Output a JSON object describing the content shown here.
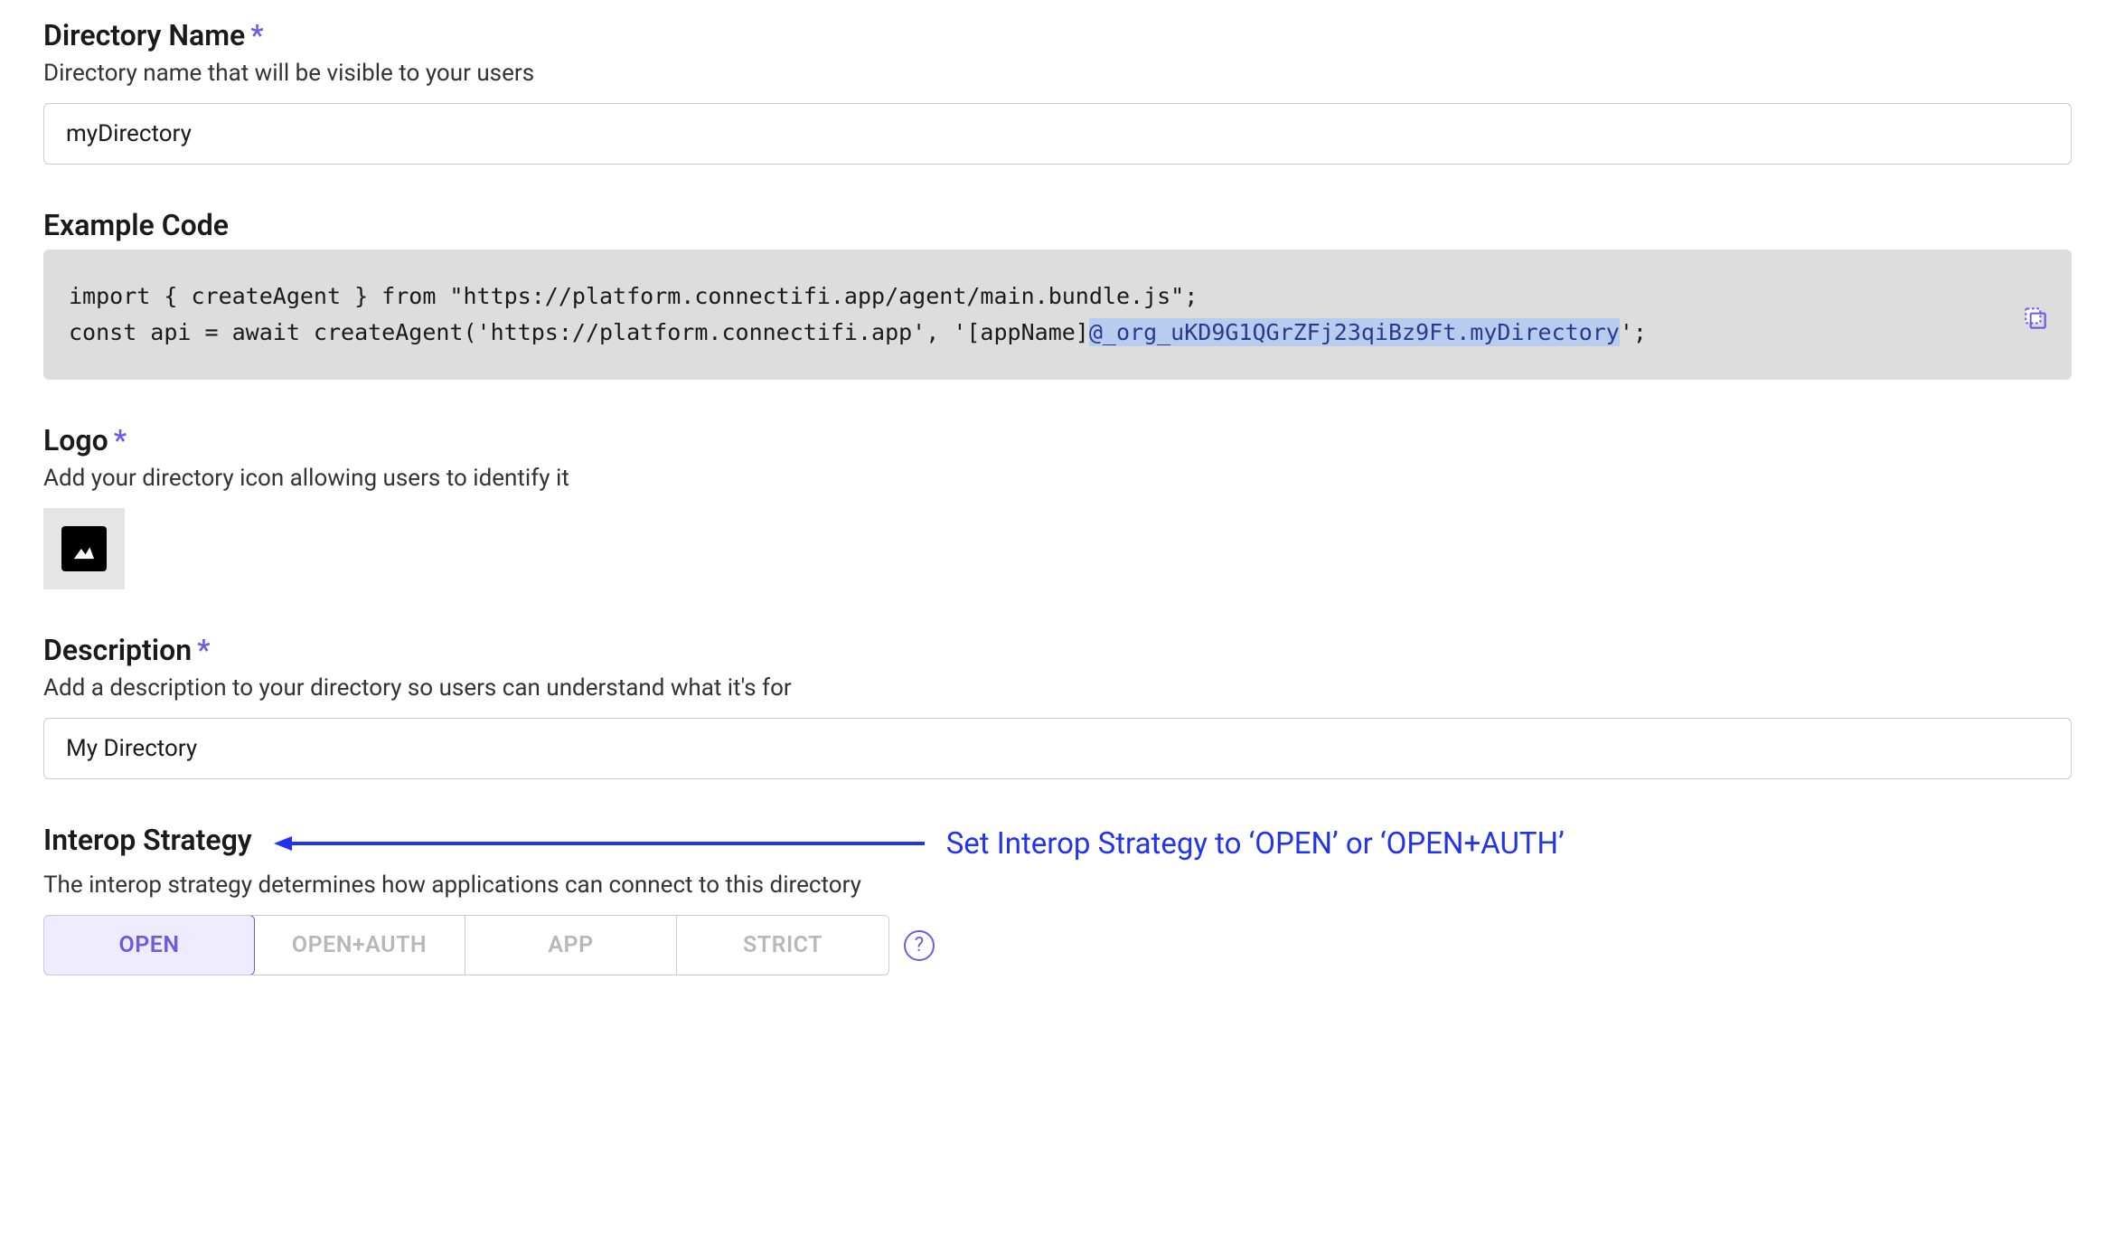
{
  "directoryName": {
    "label": "Directory Name",
    "required": "*",
    "description": "Directory name that will be visible to your users",
    "value": "myDirectory"
  },
  "exampleCode": {
    "label": "Example Code",
    "line1_pre": "import { createAgent } from \"https://platform.connectifi.app/agent/main.bundle.js\";",
    "line2_pre": "const api = await createAgent('https://platform.connectifi.app', '[appName]",
    "line2_highlight": "@_org_uKD9G1QGrZFj23qiBz9Ft.myDirectory",
    "line2_post": "';"
  },
  "logo": {
    "label": "Logo",
    "required": "*",
    "description": "Add your directory icon allowing users to identify it"
  },
  "description": {
    "label": "Description",
    "required": "*",
    "description": "Add a description to your directory so users can understand what it's for",
    "value": "My Directory"
  },
  "interopStrategy": {
    "label": "Interop Strategy",
    "description": "The interop strategy determines how applications can connect to this directory",
    "annotation": "Set Interop Strategy to ‘OPEN’ or ‘OPEN+AUTH’",
    "options": {
      "open": "OPEN",
      "openAuth": "OPEN+AUTH",
      "app": "APP",
      "strict": "STRICT"
    },
    "helpGlyph": "?"
  }
}
